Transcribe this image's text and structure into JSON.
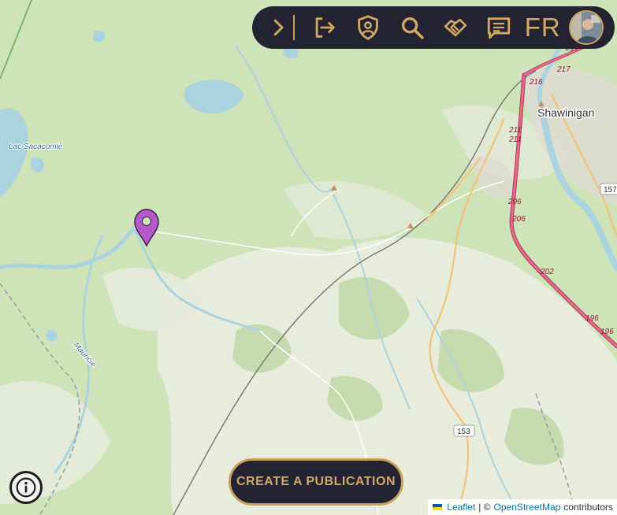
{
  "map": {
    "place_labels": [
      "Shawinigan",
      "Lac Sacacomie",
      "Mauricie"
    ],
    "route_shields": [
      "217",
      "217",
      "216",
      "211",
      "211",
      "206",
      "206",
      "202",
      "196",
      "196",
      "157",
      "153"
    ],
    "colors": {
      "forest": "#c9dfb3",
      "clearing": "#e9ece0",
      "water": "#aad3df",
      "highway": "#e46a86",
      "secondary_road": "#f2c27a",
      "urban": "#dedad4"
    }
  },
  "marker": {
    "icon": "map-pin-icon",
    "color": "#b35ac8"
  },
  "toolbar": {
    "collapse_icon": "chevron-right-icon",
    "logout_icon": "logout-icon",
    "profile_shield_icon": "shield-user-icon",
    "search_icon": "search-icon",
    "handshake_icon": "handshake-icon",
    "messages_icon": "chat-icon",
    "language": "FR",
    "accent": "#d2a866",
    "background": "#232331"
  },
  "actions": {
    "create_publication": "CREATE A PUBLICATION"
  },
  "info_button": {
    "icon": "info-icon"
  },
  "attribution": {
    "leaflet": "Leaflet",
    "separator": "| ©",
    "osm": "OpenStreetMap",
    "contributors": "contributors"
  }
}
